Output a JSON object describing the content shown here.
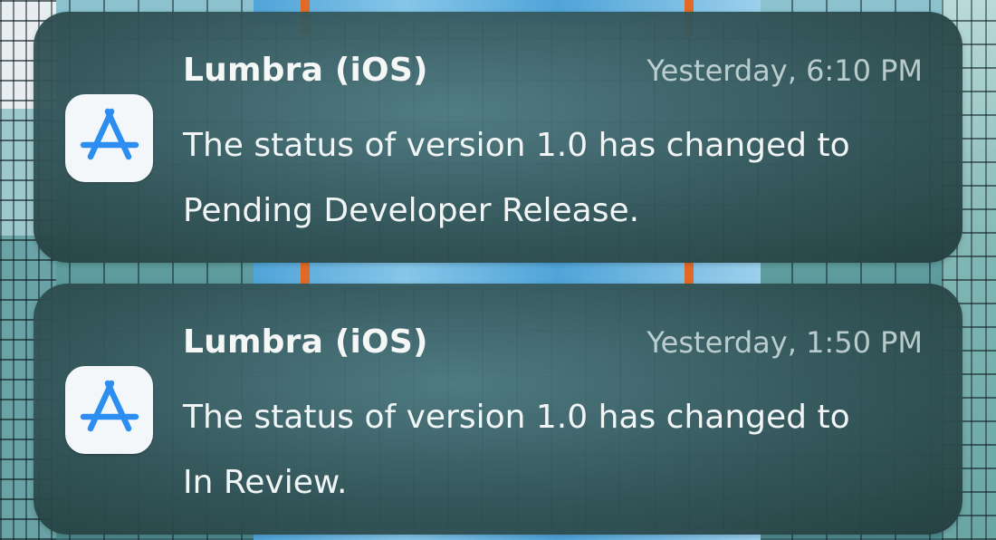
{
  "notifications": [
    {
      "app_name": "Lumbra (iOS)",
      "timestamp": "Yesterday, 6:10 PM",
      "message_line_1": "The status of version 1.0 has changed to",
      "message_line_2": "Pending Developer Release.",
      "icon": "app-store-connect-icon"
    },
    {
      "app_name": "Lumbra (iOS)",
      "timestamp": "Yesterday, 1:50 PM",
      "message_line_1": "The status of version 1.0 has changed to",
      "message_line_2": "In Review.",
      "icon": "app-store-connect-icon"
    }
  ],
  "colors": {
    "icon_blue": "#2b8ef0",
    "icon_background": "#f4f7fa",
    "card_background": "#36585c",
    "text_primary": "#f2f5f5",
    "text_secondary": "#d7e4e4"
  }
}
